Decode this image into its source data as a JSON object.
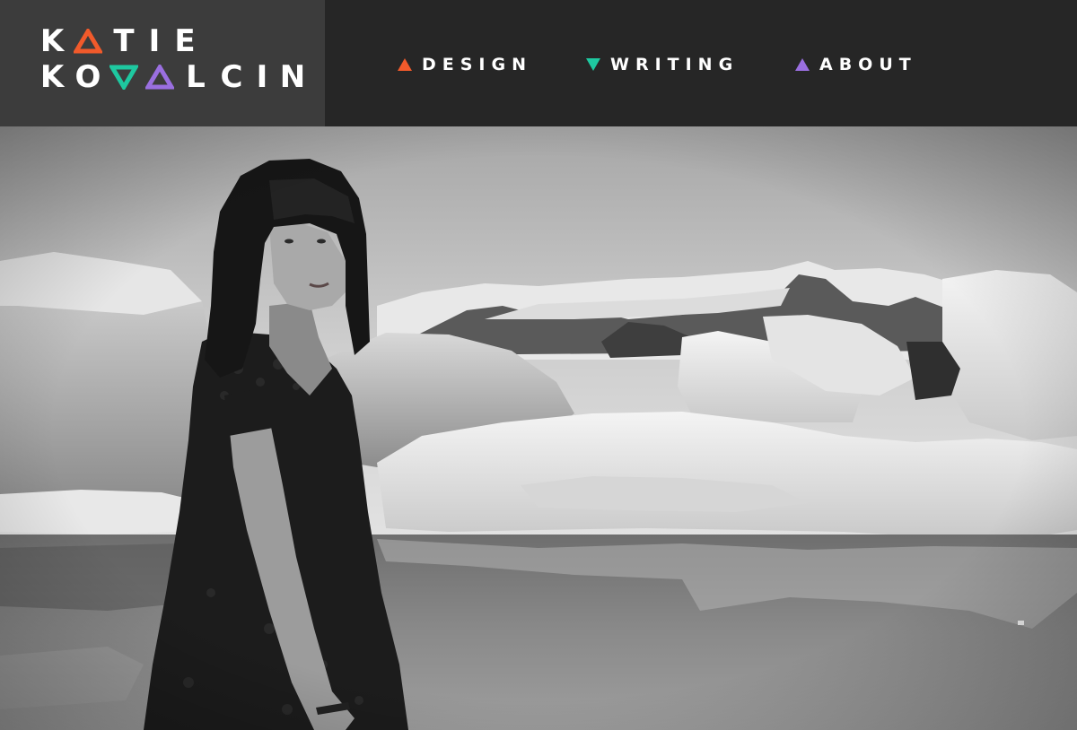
{
  "logo": {
    "line1": [
      "K",
      "",
      "T",
      "I",
      "E"
    ],
    "line2": [
      "K",
      "O",
      "",
      "",
      "L",
      "C",
      "I",
      "N"
    ],
    "icons": [
      "triangle-up-orange",
      "triangle-down-teal",
      "triangle-down-purple"
    ]
  },
  "colors": {
    "accent_orange": "#f15a2b",
    "accent_teal": "#1ec8a0",
    "accent_purple": "#9a6fe0",
    "header_bg": "#262626",
    "logo_bg": "#3c3c3c"
  },
  "nav": {
    "items": [
      {
        "label": "DESIGN",
        "icon": "triangle-up-icon",
        "color": "#f15a2b"
      },
      {
        "label": "WRITING",
        "icon": "triangle-down-icon",
        "color": "#1ec8a0"
      },
      {
        "label": "ABOUT",
        "icon": "triangle-up-icon",
        "color": "#9a6fe0"
      }
    ]
  },
  "hero": {
    "image": "black-and-white photo of a woman in a dark lace dress standing by a glacier lagoon with icebergs"
  }
}
